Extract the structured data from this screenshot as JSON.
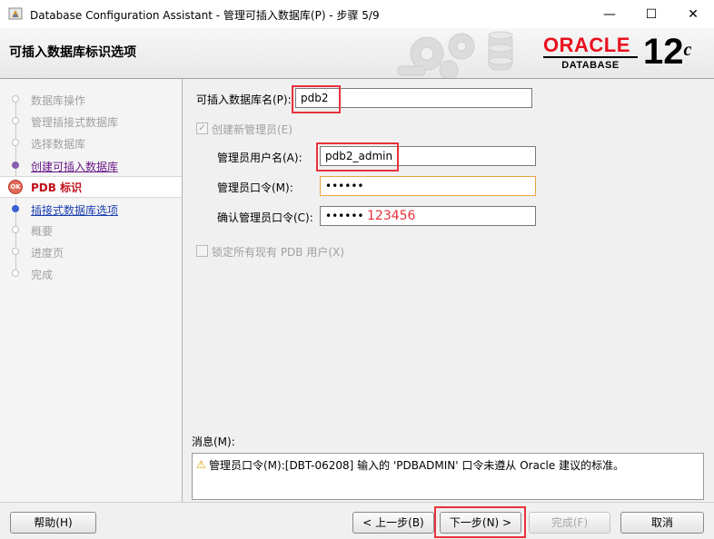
{
  "window": {
    "title": "Database Configuration Assistant - 管理可插入数据库(P) - 步骤 5/9",
    "minimize": "—",
    "maximize": "☐",
    "close": "✕"
  },
  "header": {
    "page_title": "可插入数据库标识选项",
    "brand": "ORACLE",
    "brand_sub": "DATABASE",
    "version": "12",
    "version_suffix": "c"
  },
  "steps": [
    {
      "label": "数据库操作",
      "state": "done"
    },
    {
      "label": "管理插接式数据库",
      "state": "done"
    },
    {
      "label": "选择数据库",
      "state": "done"
    },
    {
      "label": "创建可插入数据库",
      "state": "link"
    },
    {
      "label": "PDB 标识",
      "state": "current"
    },
    {
      "label": "插接式数据库选项",
      "state": "link2"
    },
    {
      "label": "概要",
      "state": "pending"
    },
    {
      "label": "进度页",
      "state": "pending"
    },
    {
      "label": "完成",
      "state": "pending"
    }
  ],
  "form": {
    "pdb_name_label": "可插入数据库名(P):",
    "pdb_name_value": "pdb2",
    "create_admin_label": "创建新管理员(E)",
    "create_admin_check": "✓",
    "admin_user_label": "管理员用户名(A):",
    "admin_user_value": "pdb2_admin",
    "admin_pwd_label": "管理员口令(M):",
    "admin_pwd_value": "••••••",
    "confirm_pwd_label": "确认管理员口令(C):",
    "confirm_pwd_value": "••••••",
    "annotation": "123456",
    "lock_users_label": "锁定所有现有 PDB 用户(X)"
  },
  "messages": {
    "label": "消息(M):",
    "warning_icon": "⚠",
    "text": "管理员口令(M):[DBT-06208] 输入的 'PDBADMIN' 口令未遵从 Oracle 建议的标准。"
  },
  "buttons": {
    "help": "帮助(H)",
    "back": "< 上一步(B)",
    "next": "下一步(N) >",
    "finish": "完成(F)",
    "cancel": "取消"
  },
  "colors": {
    "accent_red": "#e8323a",
    "oracle_red": "#e8111d",
    "current_step": "#c0101a"
  }
}
